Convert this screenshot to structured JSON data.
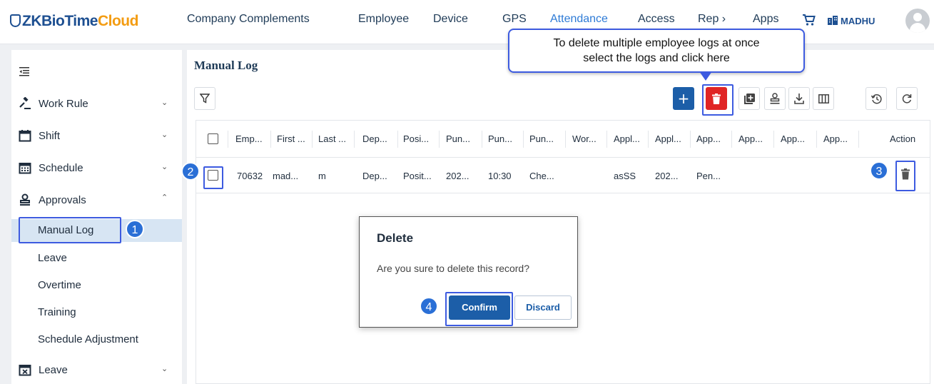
{
  "brand": {
    "name_part1": "ZKBioTime",
    "name_part2": "Cloud"
  },
  "nav": [
    {
      "label": "Company",
      "active": false
    },
    {
      "label": "Complements",
      "active": false
    },
    {
      "label": "Employee",
      "active": false
    },
    {
      "label": "Device",
      "active": false
    },
    {
      "label": "GPS",
      "active": false
    },
    {
      "label": "Attendance",
      "active": true
    },
    {
      "label": "Access",
      "active": false
    },
    {
      "label": "Rep  ›",
      "active": false
    },
    {
      "label": "Apps",
      "active": false
    }
  ],
  "user": {
    "org_name": "MADHU",
    "cart_icon": "shopping-cart-icon",
    "avatar_icon": "user-avatar-icon"
  },
  "sidebar": {
    "items": [
      {
        "label": "Work Rule",
        "icon": "gavel-icon",
        "expanded": false
      },
      {
        "label": "Shift",
        "icon": "calendar-icon",
        "expanded": false
      },
      {
        "label": "Schedule",
        "icon": "calendar-grid-icon",
        "expanded": false
      },
      {
        "label": "Approvals",
        "icon": "approval-stamp-icon",
        "expanded": true
      },
      {
        "label": "Leave",
        "icon": "calendar-x-icon",
        "expanded": false
      }
    ],
    "approvals_sub": [
      "Manual Log",
      "Leave",
      "Overtime",
      "Training",
      "Schedule Adjustment"
    ],
    "selected": "Manual Log"
  },
  "main": {
    "title": "Manual Log",
    "toolbar": {
      "filter_icon": "filter-icon",
      "add_label": "+",
      "delete_icon": "trash-icon",
      "buttons": [
        "add-box-icon",
        "stamp-icon",
        "download-icon",
        "columns-icon",
        "history-icon",
        "refresh-icon"
      ]
    }
  },
  "table": {
    "headers": [
      "Emp...",
      "First ...",
      "Last ...",
      "Dep...",
      "Posi...",
      "Pun...",
      "Pun...",
      "Pun...",
      "Wor...",
      "Appl...",
      "Appl...",
      "App...",
      "App...",
      "App...",
      "App...",
      "Action"
    ],
    "rows": [
      [
        "70632",
        "mad...",
        "m",
        "Dep...",
        "Posit...",
        "202...",
        "10:30",
        "Che...",
        "",
        "asSS",
        "202...",
        "Pen...",
        "",
        "",
        "",
        ""
      ]
    ]
  },
  "tooltip": {
    "line1": "To delete multiple employee logs at once",
    "line2": "select the logs and click here"
  },
  "dialog": {
    "title": "Delete",
    "message": "Are you sure to delete this record?",
    "confirm": "Confirm",
    "discard": "Discard"
  },
  "steps": [
    "1",
    "2",
    "3",
    "4"
  ],
  "colors": {
    "primary": "#1c5ea8",
    "danger": "#e02424",
    "highlight": "#3d5be0",
    "badge": "#2a6fd6",
    "selected_bg": "#d7e5f3"
  }
}
